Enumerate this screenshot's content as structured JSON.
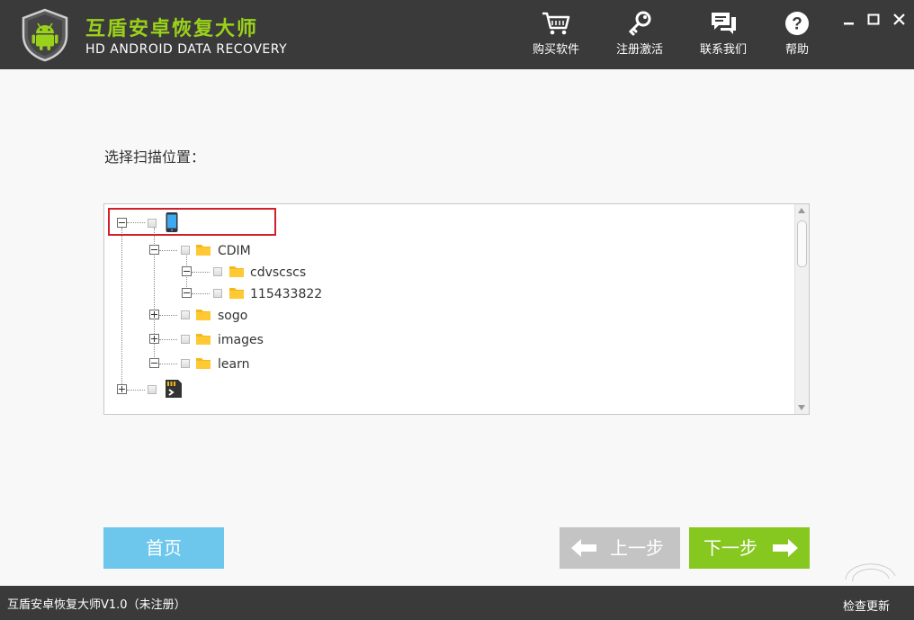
{
  "app": {
    "title": "互盾安卓恢复大师",
    "subtitle": "HD ANDROID DATA RECOVERY"
  },
  "nav": [
    {
      "label": "购买软件",
      "icon": "cart-icon"
    },
    {
      "label": "注册激活",
      "icon": "key-icon"
    },
    {
      "label": "联系我们",
      "icon": "chat-icon"
    },
    {
      "label": "帮助",
      "icon": "help-icon"
    }
  ],
  "window_controls": [
    "minimize",
    "maximize",
    "close"
  ],
  "scan": {
    "label": "选择扫描位置："
  },
  "tree": {
    "root_phone": {
      "expanded": true,
      "icon": "phone-icon"
    },
    "folders": [
      {
        "label": "CDIM",
        "expanded": true,
        "level": 1
      },
      {
        "label": "cdvscscs",
        "expanded": true,
        "level": 2
      },
      {
        "label": "115433822",
        "expanded": true,
        "level": 2
      },
      {
        "label": "sogo",
        "expanded": false,
        "level": 1
      },
      {
        "label": "images",
        "expanded": false,
        "level": 1
      },
      {
        "label": "learn",
        "expanded": true,
        "level": 1
      }
    ],
    "sd_card": {
      "expanded": false,
      "icon": "sd-card-icon"
    }
  },
  "buttons": {
    "home": "首页",
    "prev": "上一步",
    "next": "下一步"
  },
  "status": {
    "version": "互盾安卓恢复大师V1.0（未注册）",
    "update": "检查更新"
  },
  "colors": {
    "titlebar": "#3a3a3a",
    "brand_green": "#9ad21b",
    "home_blue": "#6dc7ec",
    "next_green": "#86c81f",
    "prev_gray": "#c4c4c4",
    "highlight_red": "#d0202a",
    "folder_yellow": "#f5b71b"
  }
}
